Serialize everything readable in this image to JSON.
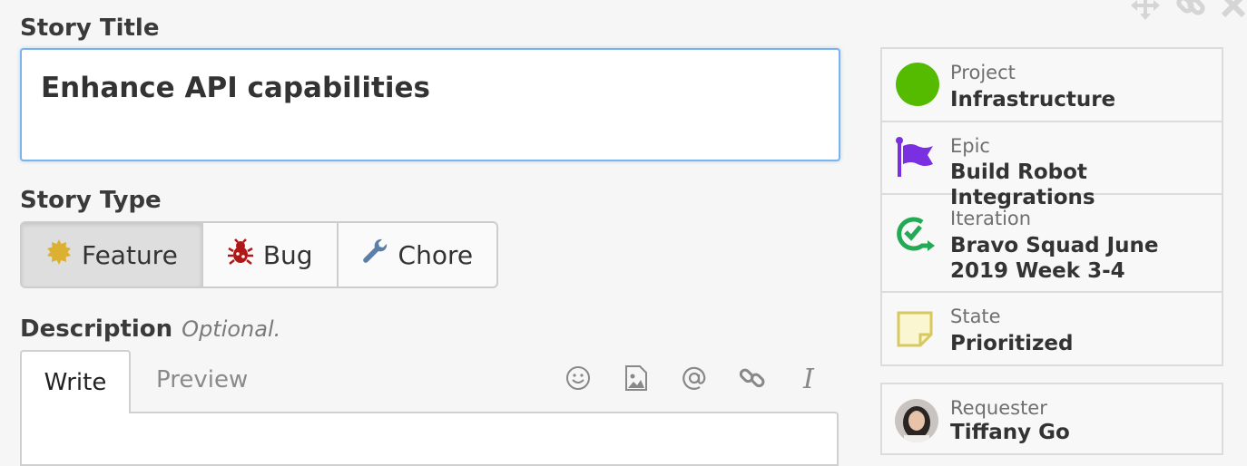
{
  "story_title": {
    "label": "Story Title",
    "value": "Enhance API capabilities"
  },
  "story_type": {
    "label": "Story Type",
    "options": [
      {
        "label": "Feature",
        "icon": "feature-star-icon",
        "selected": true
      },
      {
        "label": "Bug",
        "icon": "bug-icon",
        "selected": false
      },
      {
        "label": "Chore",
        "icon": "wrench-icon",
        "selected": false
      }
    ]
  },
  "description": {
    "label": "Description",
    "optional": "Optional.",
    "tabs": [
      {
        "label": "Write",
        "active": true
      },
      {
        "label": "Preview",
        "active": false
      }
    ],
    "toolbar": [
      "emoji-icon",
      "image-icon",
      "mention-icon",
      "link-icon",
      "italic-icon"
    ]
  },
  "details": {
    "project": {
      "key": "Project",
      "value": "Infrastructure",
      "color": "#55bb00"
    },
    "epic": {
      "key": "Epic",
      "value": "Build Robot Integrations",
      "color": "#7a2fe0"
    },
    "iteration": {
      "key": "Iteration",
      "value": "Bravo Squad June 2019 Week 3-4",
      "color": "#22aa55"
    },
    "state": {
      "key": "State",
      "value": "Prioritized",
      "color": "#d8c860"
    }
  },
  "requester": {
    "key": "Requester",
    "value": "Tiffany Go"
  },
  "colors": {
    "input_focus_border": "#7ab2ec",
    "feature_icon": "#dcb030",
    "bug_icon": "#b01818",
    "chore_icon": "#5c7fa8"
  }
}
